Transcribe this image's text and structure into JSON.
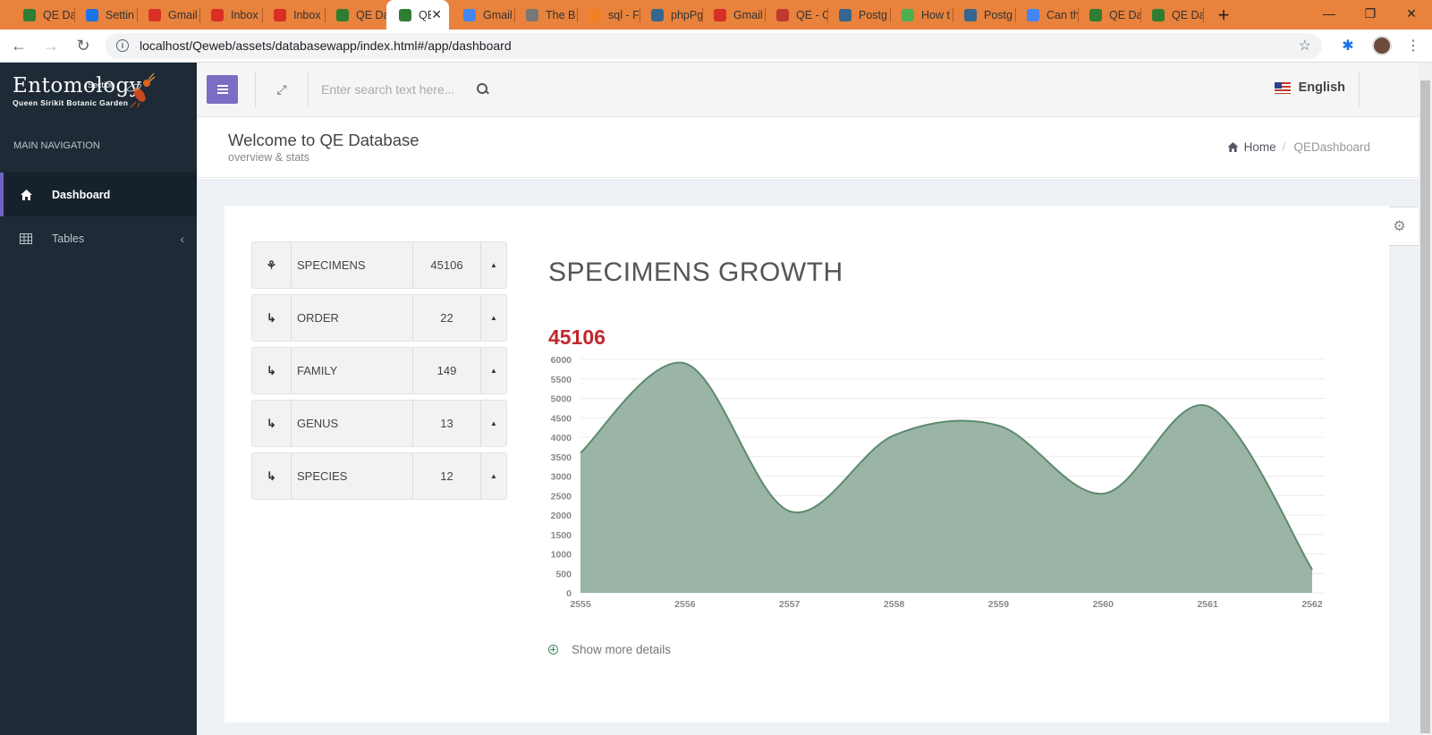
{
  "browser": {
    "tabs": [
      {
        "label": "QE Da",
        "favicon": "bug-icon",
        "color": "#2e7d32"
      },
      {
        "label": "Settin",
        "favicon": "gear-icon",
        "color": "#1a73e8"
      },
      {
        "label": "Gmail",
        "favicon": "gmail-icon",
        "color": "#d93025"
      },
      {
        "label": "Inbox",
        "favicon": "gmail-icon",
        "color": "#d93025"
      },
      {
        "label": "Inbox",
        "favicon": "gmail-icon",
        "color": "#d93025"
      },
      {
        "label": "QE Da",
        "favicon": "bug-icon",
        "color": "#2e7d32"
      },
      {
        "label": "QE",
        "favicon": "bug-icon",
        "color": "#2e7d32",
        "active": true
      },
      {
        "label": "Gmail",
        "favicon": "google-icon",
        "color": "#4285f4"
      },
      {
        "label": "The B",
        "favicon": "document-icon",
        "color": "#777777"
      },
      {
        "label": "sql - F",
        "favicon": "stackoverflow-icon",
        "color": "#f48024"
      },
      {
        "label": "phpPg",
        "favicon": "postgres-icon",
        "color": "#336791"
      },
      {
        "label": "Gmail",
        "favicon": "gmail-icon",
        "color": "#d93025"
      },
      {
        "label": "QE - C",
        "favicon": "bug-icon",
        "color": "#c0392b"
      },
      {
        "label": "Postg",
        "favicon": "postgres-icon",
        "color": "#336791"
      },
      {
        "label": "How t",
        "favicon": "leaf-icon",
        "color": "#4caf50"
      },
      {
        "label": "Postg",
        "favicon": "postgres-icon",
        "color": "#336791"
      },
      {
        "label": "Can th",
        "favicon": "google-icon",
        "color": "#4285f4"
      },
      {
        "label": "QE Da",
        "favicon": "bug-icon",
        "color": "#2e7d32"
      },
      {
        "label": "QE Da",
        "favicon": "bug-icon",
        "color": "#2e7d32"
      }
    ],
    "url": "localhost/Qeweb/assets/databasewapp/index.html#/app/dashboard"
  },
  "sidebar": {
    "logo": {
      "brand": "Entomology",
      "section": "Section",
      "subtitle": "Queen Sirikit Botanic Garden"
    },
    "nav_heading": "MAIN NAVIGATION",
    "items": [
      {
        "label": "Dashboard",
        "icon": "home-icon"
      },
      {
        "label": "Tables",
        "icon": "table-icon"
      }
    ]
  },
  "header": {
    "search_placeholder": "Enter search text here...",
    "language": "English"
  },
  "page": {
    "title": "Welcome to QE Database",
    "subtitle": "overview & stats",
    "breadcrumb": {
      "home": "Home",
      "current": "QEDashboard"
    }
  },
  "stats": [
    {
      "label": "SPECIMENS",
      "value": "45106",
      "icon": "bug-icon"
    },
    {
      "label": "ORDER",
      "value": "22",
      "icon": "level-down-icon"
    },
    {
      "label": "FAMILY",
      "value": "149",
      "icon": "level-down-icon"
    },
    {
      "label": "GENUS",
      "value": "13",
      "icon": "level-down-icon"
    },
    {
      "label": "SPECIES",
      "value": "12",
      "icon": "level-down-icon"
    }
  ],
  "chart_section": {
    "title": "SPECIMENS GROWTH",
    "total": "45106",
    "more_label": "Show more details"
  },
  "chart_data": {
    "type": "area",
    "title": "SPECIMENS GROWTH",
    "x": [
      "2555",
      "2556",
      "2557",
      "2558",
      "2559",
      "2560",
      "2561",
      "2562"
    ],
    "values": [
      3600,
      5900,
      2100,
      4050,
      4300,
      2550,
      4800,
      600
    ],
    "ylim": [
      0,
      6000
    ],
    "yticks": [
      0,
      500,
      1000,
      1500,
      2000,
      2500,
      3000,
      3500,
      4000,
      4500,
      5000,
      5500,
      6000
    ],
    "fill_color": "#9ab5a5",
    "line_color": "#5d8a6e",
    "grid": true
  }
}
